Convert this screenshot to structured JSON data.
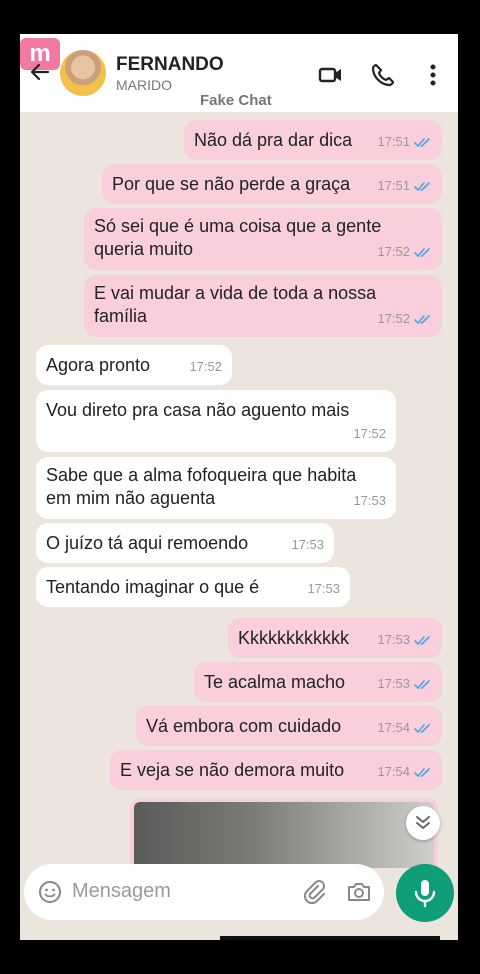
{
  "header": {
    "badge": "m",
    "name": "FERNANDO",
    "subtitle": "MARIDO",
    "watermark": "Fake Chat"
  },
  "messages": [
    {
      "dir": "out",
      "lines": [
        "Não dá pra dar dica"
      ],
      "time": "17:51"
    },
    {
      "dir": "out",
      "lines": [
        "Por que se não perde a graça"
      ],
      "time": "17:51"
    },
    {
      "dir": "out",
      "lines": [
        "Só sei que é uma coisa que a gente",
        "queria muito"
      ],
      "time": "17:52"
    },
    {
      "dir": "out",
      "lines": [
        "E vai mudar a vida de toda a nossa",
        "família"
      ],
      "time": "17:52"
    },
    {
      "dir": "in",
      "lines": [
        "Agora pronto"
      ],
      "time": "17:52"
    },
    {
      "dir": "in",
      "lines": [
        "Vou direto pra casa não aguento mais"
      ],
      "time": "17:52"
    },
    {
      "dir": "in",
      "lines": [
        "Sabe que a alma fofoqueira que habita",
        "em mim não aguenta"
      ],
      "time": "17:53"
    },
    {
      "dir": "in",
      "lines": [
        "O juízo tá aqui remoendo"
      ],
      "time": "17:53"
    },
    {
      "dir": "in",
      "lines": [
        "Tentando imaginar o que é"
      ],
      "time": "17:53"
    },
    {
      "dir": "out",
      "lines": [
        "Kkkkkkkkkkkk"
      ],
      "time": "17:53"
    },
    {
      "dir": "out",
      "lines": [
        "Te acalma macho"
      ],
      "time": "17:53"
    },
    {
      "dir": "out",
      "lines": [
        "Vá embora com cuidado"
      ],
      "time": "17:54"
    },
    {
      "dir": "out",
      "lines": [
        "E veja se não demora muito"
      ],
      "time": "17:54"
    }
  ],
  "composer": {
    "placeholder": "Mensagem"
  },
  "colors": {
    "outgoing_bubble": "#f8cfda",
    "incoming_bubble": "#ffffff",
    "tick": "#4fa3e0",
    "mic_button": "#0f9d7a"
  }
}
